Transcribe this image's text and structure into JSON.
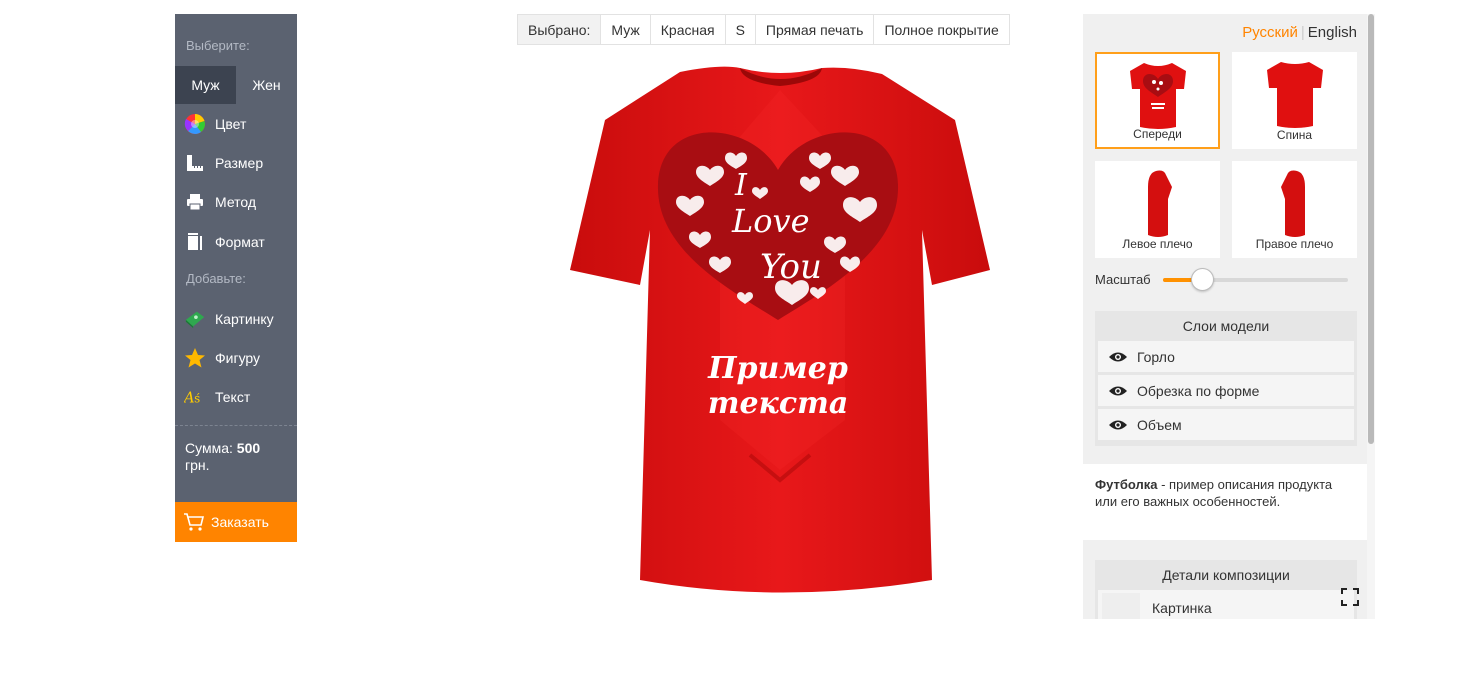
{
  "sidebar": {
    "choose_label": "Выберите:",
    "gender": [
      "Муж",
      "Жен"
    ],
    "items": [
      {
        "label": "Цвет",
        "icon": "color-wheel-icon"
      },
      {
        "label": "Размер",
        "icon": "ruler-icon"
      },
      {
        "label": "Метод",
        "icon": "printer-icon"
      },
      {
        "label": "Формат",
        "icon": "format-icon"
      }
    ],
    "add_label": "Добавьте:",
    "add_items": [
      {
        "label": "Картинку",
        "icon": "image-icon"
      },
      {
        "label": "Фигуру",
        "icon": "star-icon"
      },
      {
        "label": "Текст",
        "icon": "text-icon"
      }
    ],
    "sum_label": "Сумма:",
    "sum_value": "500",
    "sum_currency": "грн.",
    "order_label": "Заказать"
  },
  "selection": {
    "label": "Выбрано:",
    "values": [
      "Муж",
      "Красная",
      "S",
      "Прямая печать",
      "Полное покрытие"
    ]
  },
  "shirt": {
    "line1": "I",
    "line2": "Love",
    "line3": "You",
    "text_line1": "Пример",
    "text_line2": "текста",
    "color": "#e01010"
  },
  "right_panel": {
    "lang_ru": "Русский",
    "lang_en": "English",
    "views": [
      {
        "label": "Спереди"
      },
      {
        "label": "Спина"
      },
      {
        "label": "Левое плечо"
      },
      {
        "label": "Правое плечо"
      }
    ],
    "scale_label": "Масштаб",
    "scale_value": 0.17,
    "layers_title": "Слои модели",
    "layers": [
      "Горло",
      "Обрезка по форме",
      "Объем"
    ],
    "desc_bold": "Футболка",
    "desc_text": " - пример описания продукта или его важных особенностей.",
    "comp_title": "Детали композиции",
    "comp_items": [
      "Картинка"
    ]
  },
  "colors": {
    "accent": "#ff8400",
    "sidebar_bg": "#5b6270",
    "shirt_red": "#e01010"
  }
}
